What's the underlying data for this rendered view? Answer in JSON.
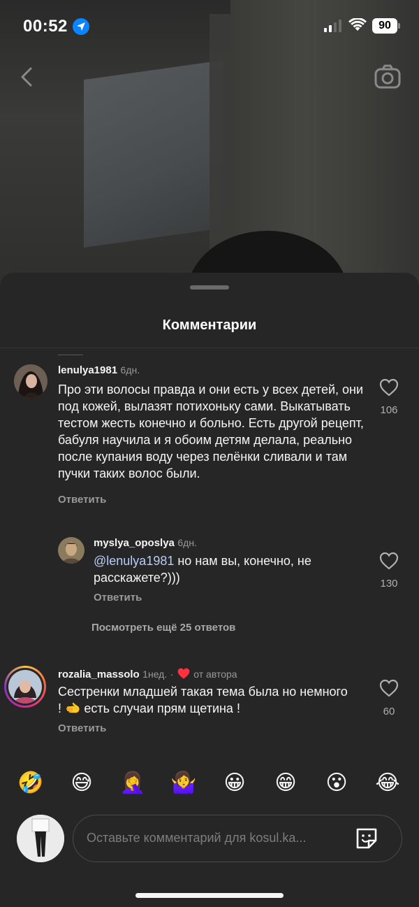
{
  "status_bar": {
    "time": "00:52",
    "battery": "90"
  },
  "sheet": {
    "title": "Комментарии"
  },
  "comments": [
    {
      "username": "lenulya1981",
      "age": "6дн.",
      "text": "Про эти волосы правда и они есть у всех детей, они под кожей,  вылазят потихоньку сами. Выкатывать тестом жесть конечно и больно. Есть другой рецепт, бабуля научила и я обоим детям делала, реально после купания воду через пелёнки сливали и там пучки таких волос были.",
      "reply_label": "Ответить",
      "likes": "106"
    },
    {
      "username": "myslya_oposlya",
      "age": "6дн.",
      "mention": "@lenulya1981",
      "text": " но нам вы, конечно, не расскажете?)))",
      "reply_label": "Ответить",
      "likes": "130"
    },
    {
      "username": "rozalia_massolo",
      "age": "1нед.",
      "separator": "·",
      "author_badge": "от автора",
      "text": "Сестренки младшей такая тема была но немного ! 🫲 есть случаи прям щетина !",
      "reply_label": "Ответить",
      "likes": "60"
    }
  ],
  "view_more": "Посмотреть ещё 25 ответов",
  "emoji_bar": [
    "🤣",
    "😅",
    "🤦‍♀️",
    "🤷‍♀️",
    "😀",
    "😁",
    "😮",
    "😂"
  ],
  "composer": {
    "placeholder": "Оставьте комментарий для kosul.ka..."
  },
  "colors": {
    "sheet_bg": "#262626",
    "heart_red": "#ff3040",
    "mention": "#b8cdf5",
    "location_blue": "#0a84ff"
  },
  "icons": {
    "back": "chevron-left-icon",
    "camera": "camera-icon",
    "like": "heart-outline-icon",
    "sticker": "sticker-icon"
  }
}
